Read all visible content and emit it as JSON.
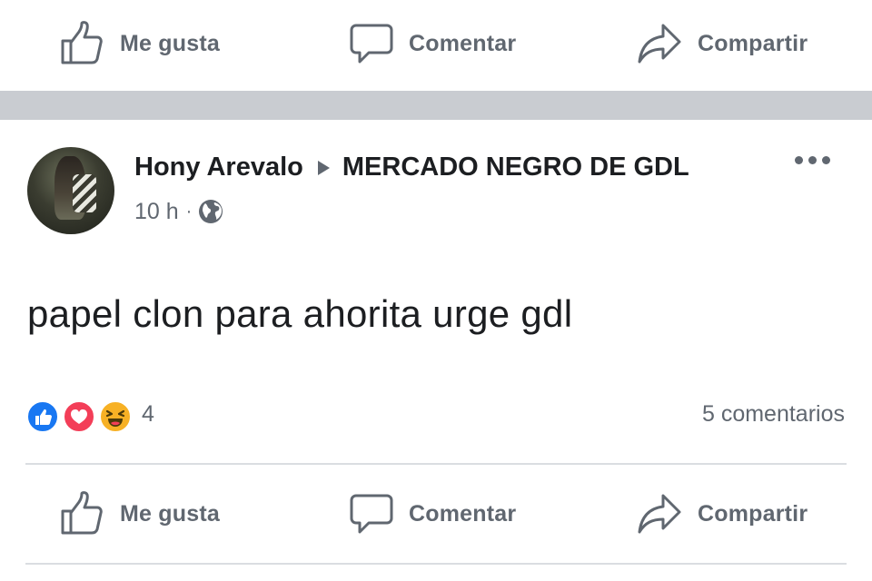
{
  "top_actions": {
    "like_label": "Me gusta",
    "comment_label": "Comentar",
    "share_label": "Compartir"
  },
  "post": {
    "author": "Hony Arevalo",
    "group": "MERCADO NEGRO DE GDL",
    "time": "10 h",
    "meta_separator": "·",
    "privacy_icon": "globe-icon",
    "text": "papel clon para ahorita urge gdl",
    "reactions": [
      "like",
      "love",
      "haha"
    ],
    "reaction_count": "4",
    "comments": "5 comentarios"
  },
  "bottom_actions": {
    "like_label": "Me gusta",
    "comment_label": "Comentar",
    "share_label": "Compartir"
  },
  "colors": {
    "separator": "#c9ccd1",
    "secondary_text": "#606770",
    "like_blue": "#1877f2",
    "love_red": "#f33e58",
    "haha_yellow": "#f7b125"
  }
}
